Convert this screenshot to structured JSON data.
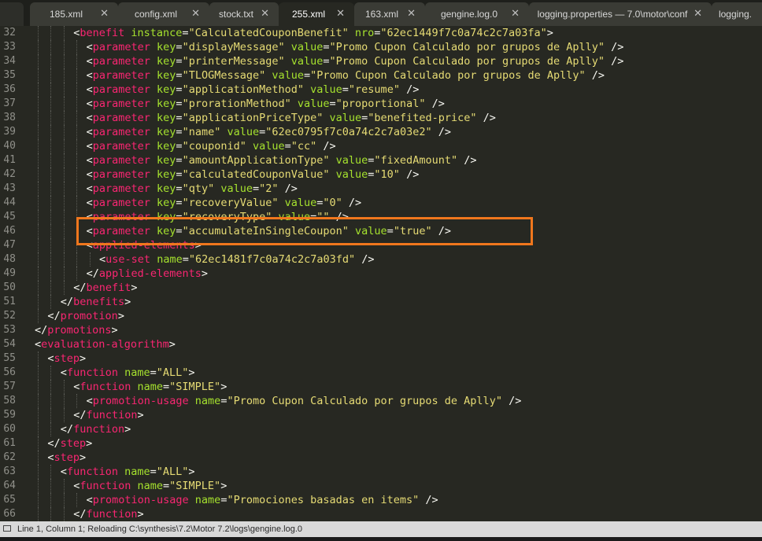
{
  "tabs": [
    {
      "label": "185.xml",
      "active": false
    },
    {
      "label": "config.xml",
      "active": false
    },
    {
      "label": "stock.txt",
      "active": false
    },
    {
      "label": "255.xml",
      "active": true
    },
    {
      "label": "163.xml",
      "active": false
    },
    {
      "label": "gengine.log.0",
      "active": false
    },
    {
      "label": "logging.properties — 7.0\\motor\\conf",
      "active": false
    },
    {
      "label": "logging.",
      "active": false
    }
  ],
  "close_glyph": "✕",
  "status": {
    "text": "Line 1, Column 1; Reloading C:\\synthesis\\7.2\\Motor 7.2\\logs\\gengine.log.0"
  },
  "highlight": {
    "line": 46,
    "color": "#f0771d"
  },
  "colors": {
    "background": "#272822",
    "tag": "#f92672",
    "attribute": "#a6e22e",
    "string": "#e6db74",
    "punctuation": "#f8f8f2",
    "line_number": "#90908a"
  },
  "code_lines": [
    {
      "n": "32",
      "indent": 6,
      "tokens": [
        [
          "p",
          "<"
        ],
        [
          "t",
          "benefit"
        ],
        [
          "p",
          " "
        ],
        [
          "a",
          "instance"
        ],
        [
          "p",
          "="
        ],
        [
          "s",
          "\"CalculatedCouponBenefit\""
        ],
        [
          "p",
          " "
        ],
        [
          "a",
          "nro"
        ],
        [
          "p",
          "="
        ],
        [
          "s",
          "\"62ec1449f7c0a74c2c7a03fa\""
        ],
        [
          "p",
          ">"
        ]
      ]
    },
    {
      "n": "33",
      "indent": 8,
      "tokens": [
        [
          "p",
          "<"
        ],
        [
          "t",
          "parameter"
        ],
        [
          "p",
          " "
        ],
        [
          "a",
          "key"
        ],
        [
          "p",
          "="
        ],
        [
          "s",
          "\"displayMessage\""
        ],
        [
          "p",
          " "
        ],
        [
          "a",
          "value"
        ],
        [
          "p",
          "="
        ],
        [
          "s",
          "\"Promo Cupon Calculado por grupos de Aplly\""
        ],
        [
          "p",
          " />"
        ]
      ]
    },
    {
      "n": "34",
      "indent": 8,
      "tokens": [
        [
          "p",
          "<"
        ],
        [
          "t",
          "parameter"
        ],
        [
          "p",
          " "
        ],
        [
          "a",
          "key"
        ],
        [
          "p",
          "="
        ],
        [
          "s",
          "\"printerMessage\""
        ],
        [
          "p",
          " "
        ],
        [
          "a",
          "value"
        ],
        [
          "p",
          "="
        ],
        [
          "s",
          "\"Promo Cupon Calculado por grupos de Aplly\""
        ],
        [
          "p",
          " />"
        ]
      ]
    },
    {
      "n": "35",
      "indent": 8,
      "tokens": [
        [
          "p",
          "<"
        ],
        [
          "t",
          "parameter"
        ],
        [
          "p",
          " "
        ],
        [
          "a",
          "key"
        ],
        [
          "p",
          "="
        ],
        [
          "s",
          "\"TLOGMessage\""
        ],
        [
          "p",
          " "
        ],
        [
          "a",
          "value"
        ],
        [
          "p",
          "="
        ],
        [
          "s",
          "\"Promo Cupon Calculado por grupos de Aplly\""
        ],
        [
          "p",
          " />"
        ]
      ]
    },
    {
      "n": "36",
      "indent": 8,
      "tokens": [
        [
          "p",
          "<"
        ],
        [
          "t",
          "parameter"
        ],
        [
          "p",
          " "
        ],
        [
          "a",
          "key"
        ],
        [
          "p",
          "="
        ],
        [
          "s",
          "\"applicationMethod\""
        ],
        [
          "p",
          " "
        ],
        [
          "a",
          "value"
        ],
        [
          "p",
          "="
        ],
        [
          "s",
          "\"resume\""
        ],
        [
          "p",
          " />"
        ]
      ]
    },
    {
      "n": "37",
      "indent": 8,
      "tokens": [
        [
          "p",
          "<"
        ],
        [
          "t",
          "parameter"
        ],
        [
          "p",
          " "
        ],
        [
          "a",
          "key"
        ],
        [
          "p",
          "="
        ],
        [
          "s",
          "\"prorationMethod\""
        ],
        [
          "p",
          " "
        ],
        [
          "a",
          "value"
        ],
        [
          "p",
          "="
        ],
        [
          "s",
          "\"proportional\""
        ],
        [
          "p",
          " />"
        ]
      ]
    },
    {
      "n": "38",
      "indent": 8,
      "tokens": [
        [
          "p",
          "<"
        ],
        [
          "t",
          "parameter"
        ],
        [
          "p",
          " "
        ],
        [
          "a",
          "key"
        ],
        [
          "p",
          "="
        ],
        [
          "s",
          "\"applicationPriceType\""
        ],
        [
          "p",
          " "
        ],
        [
          "a",
          "value"
        ],
        [
          "p",
          "="
        ],
        [
          "s",
          "\"benefited-price\""
        ],
        [
          "p",
          " />"
        ]
      ]
    },
    {
      "n": "39",
      "indent": 8,
      "tokens": [
        [
          "p",
          "<"
        ],
        [
          "t",
          "parameter"
        ],
        [
          "p",
          " "
        ],
        [
          "a",
          "key"
        ],
        [
          "p",
          "="
        ],
        [
          "s",
          "\"name\""
        ],
        [
          "p",
          " "
        ],
        [
          "a",
          "value"
        ],
        [
          "p",
          "="
        ],
        [
          "s",
          "\"62ec0795f7c0a74c2c7a03e2\""
        ],
        [
          "p",
          " />"
        ]
      ]
    },
    {
      "n": "40",
      "indent": 8,
      "tokens": [
        [
          "p",
          "<"
        ],
        [
          "t",
          "parameter"
        ],
        [
          "p",
          " "
        ],
        [
          "a",
          "key"
        ],
        [
          "p",
          "="
        ],
        [
          "s",
          "\"couponid\""
        ],
        [
          "p",
          " "
        ],
        [
          "a",
          "value"
        ],
        [
          "p",
          "="
        ],
        [
          "s",
          "\"cc\""
        ],
        [
          "p",
          " />"
        ]
      ]
    },
    {
      "n": "41",
      "indent": 8,
      "tokens": [
        [
          "p",
          "<"
        ],
        [
          "t",
          "parameter"
        ],
        [
          "p",
          " "
        ],
        [
          "a",
          "key"
        ],
        [
          "p",
          "="
        ],
        [
          "s",
          "\"amountApplicationType\""
        ],
        [
          "p",
          " "
        ],
        [
          "a",
          "value"
        ],
        [
          "p",
          "="
        ],
        [
          "s",
          "\"fixedAmount\""
        ],
        [
          "p",
          " />"
        ]
      ]
    },
    {
      "n": "42",
      "indent": 8,
      "tokens": [
        [
          "p",
          "<"
        ],
        [
          "t",
          "parameter"
        ],
        [
          "p",
          " "
        ],
        [
          "a",
          "key"
        ],
        [
          "p",
          "="
        ],
        [
          "s",
          "\"calculatedCouponValue\""
        ],
        [
          "p",
          " "
        ],
        [
          "a",
          "value"
        ],
        [
          "p",
          "="
        ],
        [
          "s",
          "\"10\""
        ],
        [
          "p",
          " />"
        ]
      ]
    },
    {
      "n": "43",
      "indent": 8,
      "tokens": [
        [
          "p",
          "<"
        ],
        [
          "t",
          "parameter"
        ],
        [
          "p",
          " "
        ],
        [
          "a",
          "key"
        ],
        [
          "p",
          "="
        ],
        [
          "s",
          "\"qty\""
        ],
        [
          "p",
          " "
        ],
        [
          "a",
          "value"
        ],
        [
          "p",
          "="
        ],
        [
          "s",
          "\"2\""
        ],
        [
          "p",
          " />"
        ]
      ]
    },
    {
      "n": "44",
      "indent": 8,
      "tokens": [
        [
          "p",
          "<"
        ],
        [
          "t",
          "parameter"
        ],
        [
          "p",
          " "
        ],
        [
          "a",
          "key"
        ],
        [
          "p",
          "="
        ],
        [
          "s",
          "\"recoveryValue\""
        ],
        [
          "p",
          " "
        ],
        [
          "a",
          "value"
        ],
        [
          "p",
          "="
        ],
        [
          "s",
          "\"0\""
        ],
        [
          "p",
          " />"
        ]
      ]
    },
    {
      "n": "45",
      "indent": 8,
      "tokens": [
        [
          "p",
          "<"
        ],
        [
          "t",
          "parameter"
        ],
        [
          "p",
          " "
        ],
        [
          "a",
          "key"
        ],
        [
          "p",
          "="
        ],
        [
          "s",
          "\"recoveryType\""
        ],
        [
          "p",
          " "
        ],
        [
          "a",
          "value"
        ],
        [
          "p",
          "="
        ],
        [
          "s",
          "\"\""
        ],
        [
          "p",
          " />"
        ]
      ]
    },
    {
      "n": "46",
      "indent": 8,
      "tokens": [
        [
          "p",
          "<"
        ],
        [
          "t",
          "parameter"
        ],
        [
          "p",
          " "
        ],
        [
          "a",
          "key"
        ],
        [
          "p",
          "="
        ],
        [
          "s",
          "\"accumulateInSingleCoupon\""
        ],
        [
          "p",
          " "
        ],
        [
          "a",
          "value"
        ],
        [
          "p",
          "="
        ],
        [
          "s",
          "\"true\""
        ],
        [
          "p",
          " />"
        ]
      ]
    },
    {
      "n": "47",
      "indent": 8,
      "tokens": [
        [
          "p",
          "<"
        ],
        [
          "t",
          "applied-elements"
        ],
        [
          "p",
          ">"
        ]
      ]
    },
    {
      "n": "48",
      "indent": 10,
      "tokens": [
        [
          "p",
          "<"
        ],
        [
          "t",
          "use-set"
        ],
        [
          "p",
          " "
        ],
        [
          "a",
          "name"
        ],
        [
          "p",
          "="
        ],
        [
          "s",
          "\"62ec1481f7c0a74c2c7a03fd\""
        ],
        [
          "p",
          " />"
        ]
      ]
    },
    {
      "n": "49",
      "indent": 8,
      "tokens": [
        [
          "p",
          "</"
        ],
        [
          "t",
          "applied-elements"
        ],
        [
          "p",
          ">"
        ]
      ]
    },
    {
      "n": "50",
      "indent": 6,
      "tokens": [
        [
          "p",
          "</"
        ],
        [
          "t",
          "benefit"
        ],
        [
          "p",
          ">"
        ]
      ]
    },
    {
      "n": "51",
      "indent": 4,
      "tokens": [
        [
          "p",
          "</"
        ],
        [
          "t",
          "benefits"
        ],
        [
          "p",
          ">"
        ]
      ]
    },
    {
      "n": "52",
      "indent": 2,
      "tokens": [
        [
          "p",
          "</"
        ],
        [
          "t",
          "promotion"
        ],
        [
          "p",
          ">"
        ]
      ]
    },
    {
      "n": "53",
      "indent": 0,
      "tokens": [
        [
          "p",
          "</"
        ],
        [
          "t",
          "promotions"
        ],
        [
          "p",
          ">"
        ]
      ]
    },
    {
      "n": "54",
      "indent": 0,
      "tokens": [
        [
          "p",
          "<"
        ],
        [
          "t",
          "evaluation-algorithm"
        ],
        [
          "p",
          ">"
        ]
      ]
    },
    {
      "n": "55",
      "indent": 2,
      "tokens": [
        [
          "p",
          "<"
        ],
        [
          "t",
          "step"
        ],
        [
          "p",
          ">"
        ]
      ]
    },
    {
      "n": "56",
      "indent": 4,
      "tokens": [
        [
          "p",
          "<"
        ],
        [
          "t",
          "function"
        ],
        [
          "p",
          " "
        ],
        [
          "a",
          "name"
        ],
        [
          "p",
          "="
        ],
        [
          "s",
          "\"ALL\""
        ],
        [
          "p",
          ">"
        ]
      ]
    },
    {
      "n": "57",
      "indent": 6,
      "tokens": [
        [
          "p",
          "<"
        ],
        [
          "t",
          "function"
        ],
        [
          "p",
          " "
        ],
        [
          "a",
          "name"
        ],
        [
          "p",
          "="
        ],
        [
          "s",
          "\"SIMPLE\""
        ],
        [
          "p",
          ">"
        ]
      ]
    },
    {
      "n": "58",
      "indent": 8,
      "tokens": [
        [
          "p",
          "<"
        ],
        [
          "t",
          "promotion-usage"
        ],
        [
          "p",
          " "
        ],
        [
          "a",
          "name"
        ],
        [
          "p",
          "="
        ],
        [
          "s",
          "\"Promo Cupon Calculado por grupos de Aplly\""
        ],
        [
          "p",
          " />"
        ]
      ]
    },
    {
      "n": "59",
      "indent": 6,
      "tokens": [
        [
          "p",
          "</"
        ],
        [
          "t",
          "function"
        ],
        [
          "p",
          ">"
        ]
      ]
    },
    {
      "n": "60",
      "indent": 4,
      "tokens": [
        [
          "p",
          "</"
        ],
        [
          "t",
          "function"
        ],
        [
          "p",
          ">"
        ]
      ]
    },
    {
      "n": "61",
      "indent": 2,
      "tokens": [
        [
          "p",
          "</"
        ],
        [
          "t",
          "step"
        ],
        [
          "p",
          ">"
        ]
      ]
    },
    {
      "n": "62",
      "indent": 2,
      "tokens": [
        [
          "p",
          "<"
        ],
        [
          "t",
          "step"
        ],
        [
          "p",
          ">"
        ]
      ]
    },
    {
      "n": "63",
      "indent": 4,
      "tokens": [
        [
          "p",
          "<"
        ],
        [
          "t",
          "function"
        ],
        [
          "p",
          " "
        ],
        [
          "a",
          "name"
        ],
        [
          "p",
          "="
        ],
        [
          "s",
          "\"ALL\""
        ],
        [
          "p",
          ">"
        ]
      ]
    },
    {
      "n": "64",
      "indent": 6,
      "tokens": [
        [
          "p",
          "<"
        ],
        [
          "t",
          "function"
        ],
        [
          "p",
          " "
        ],
        [
          "a",
          "name"
        ],
        [
          "p",
          "="
        ],
        [
          "s",
          "\"SIMPLE\""
        ],
        [
          "p",
          ">"
        ]
      ]
    },
    {
      "n": "65",
      "indent": 8,
      "tokens": [
        [
          "p",
          "<"
        ],
        [
          "t",
          "promotion-usage"
        ],
        [
          "p",
          " "
        ],
        [
          "a",
          "name"
        ],
        [
          "p",
          "="
        ],
        [
          "s",
          "\"Promociones basadas en items\""
        ],
        [
          "p",
          " />"
        ]
      ]
    },
    {
      "n": "66",
      "indent": 6,
      "tokens": [
        [
          "p",
          "</"
        ],
        [
          "t",
          "function"
        ],
        [
          "p",
          ">"
        ]
      ]
    }
  ]
}
